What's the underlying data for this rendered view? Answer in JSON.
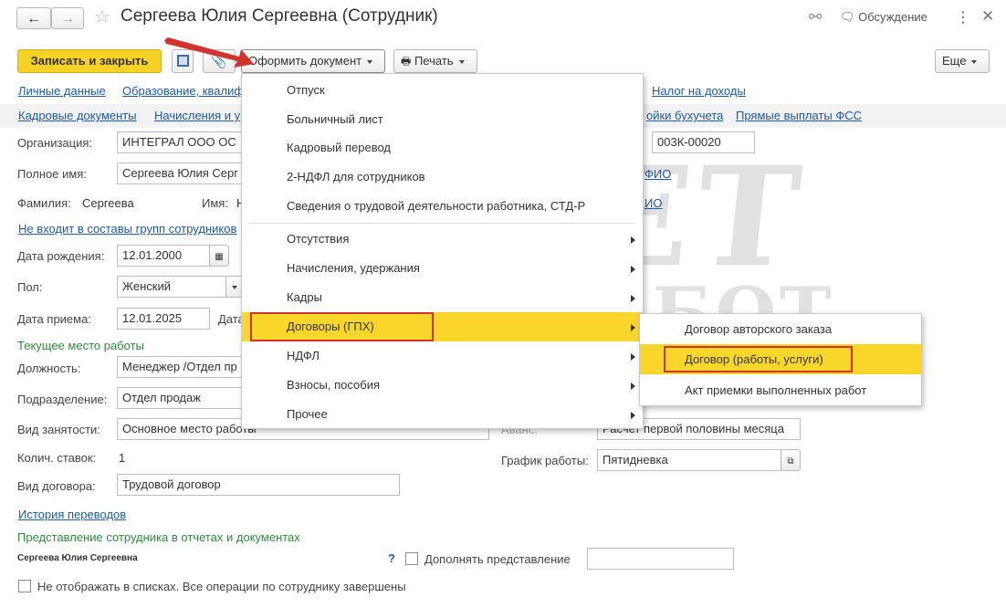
{
  "window": {
    "title": "Сергеева Юлия Сергеевна (Сотрудник)",
    "discussion_label": "Обсуждение"
  },
  "toolbar": {
    "save_close": "Записать и закрыть",
    "create_doc": "Оформить документ",
    "print": "Печать",
    "more": "Еще"
  },
  "links_row1": {
    "personal": "Личные данные",
    "education": "Образование, квалиф",
    "tax": "Налог на доходы"
  },
  "links_row2": {
    "hr_docs": "Кадровые документы",
    "accruals": "Начисления и у",
    "accounting": "ойки бухучета",
    "fss": "Прямые выплаты ФСС"
  },
  "form": {
    "org_label": "Организация:",
    "org_value": "ИНТЕГРАЛ ООО ОС",
    "code_value": "003К-00020",
    "fullname_label": "Полное имя:",
    "fullname_value": "Сергеева Юлия Серг",
    "fio_link1": "ФИО",
    "surname_label": "Фамилия:",
    "surname_value": "Сергеева",
    "name_label": "Имя:",
    "name_value": "Н",
    "fio_link2": "ИО",
    "groups_link": "Не входит в составы групп сотрудников",
    "birth_label": "Дата рождения:",
    "birth_value": "12.01.2000",
    "gender_label": "Пол:",
    "gender_value": "Женский",
    "hire_label": "Дата приема:",
    "hire_value": "12.01.2025",
    "hire_cut_label": "Дата",
    "current_place_title": "Текущее место работы",
    "position_label": "Должность:",
    "position_value": "Менеджер /Отдел пр",
    "department_label": "Подразделение:",
    "department_value": "Отдел продаж",
    "employment_label": "Вид занятости:",
    "employment_value": "Основное место работы",
    "advance_label": "Аванс:",
    "advance_value": "Расчет первой половины месяца",
    "rates_label": "Колич. ставок:",
    "rates_value": "1",
    "schedule_label": "График работы:",
    "schedule_value": "Пятидневка",
    "contract_label": "Вид договора:",
    "contract_value": "Трудовой договор",
    "history_link": "История переводов",
    "representation_title": "Представление сотрудника в отчетах и документах",
    "representation_value": "Сергеева Юлия Сергеевна",
    "help_mark": "?",
    "supplement_label": "Дополнять представление",
    "hide_label": "Не отображать в списках. Все операции по сотруднику завершены"
  },
  "menu": {
    "items": [
      {
        "label": "Отпуск"
      },
      {
        "label": "Больничный лист"
      },
      {
        "label": "Кадровый перевод"
      },
      {
        "label": "2-НДФЛ для сотрудников"
      },
      {
        "label": "Сведения о трудовой деятельности работника, СТД-Р"
      },
      {
        "label": "Отсутствия"
      },
      {
        "label": "Начисления, удержания"
      },
      {
        "label": "Кадры"
      },
      {
        "label": "Договоры (ГПХ)"
      },
      {
        "label": "НДФЛ"
      },
      {
        "label": "Взносы, пособия"
      },
      {
        "label": "Прочее"
      }
    ]
  },
  "submenu": {
    "items": [
      {
        "label": "Договор авторского заказа"
      },
      {
        "label": "Договор (работы, услуги)"
      },
      {
        "label": "Акт приемки выполненных работ"
      }
    ]
  },
  "watermark": {
    "line1": "УЧЕТ",
    "line2": "БЕЗ ЗАБОТ"
  },
  "colors": {
    "accent_yellow": "#f9d62a",
    "highlight_red": "#d0342c",
    "link_blue": "#1c5bab",
    "section_green": "#2e8b3c"
  }
}
